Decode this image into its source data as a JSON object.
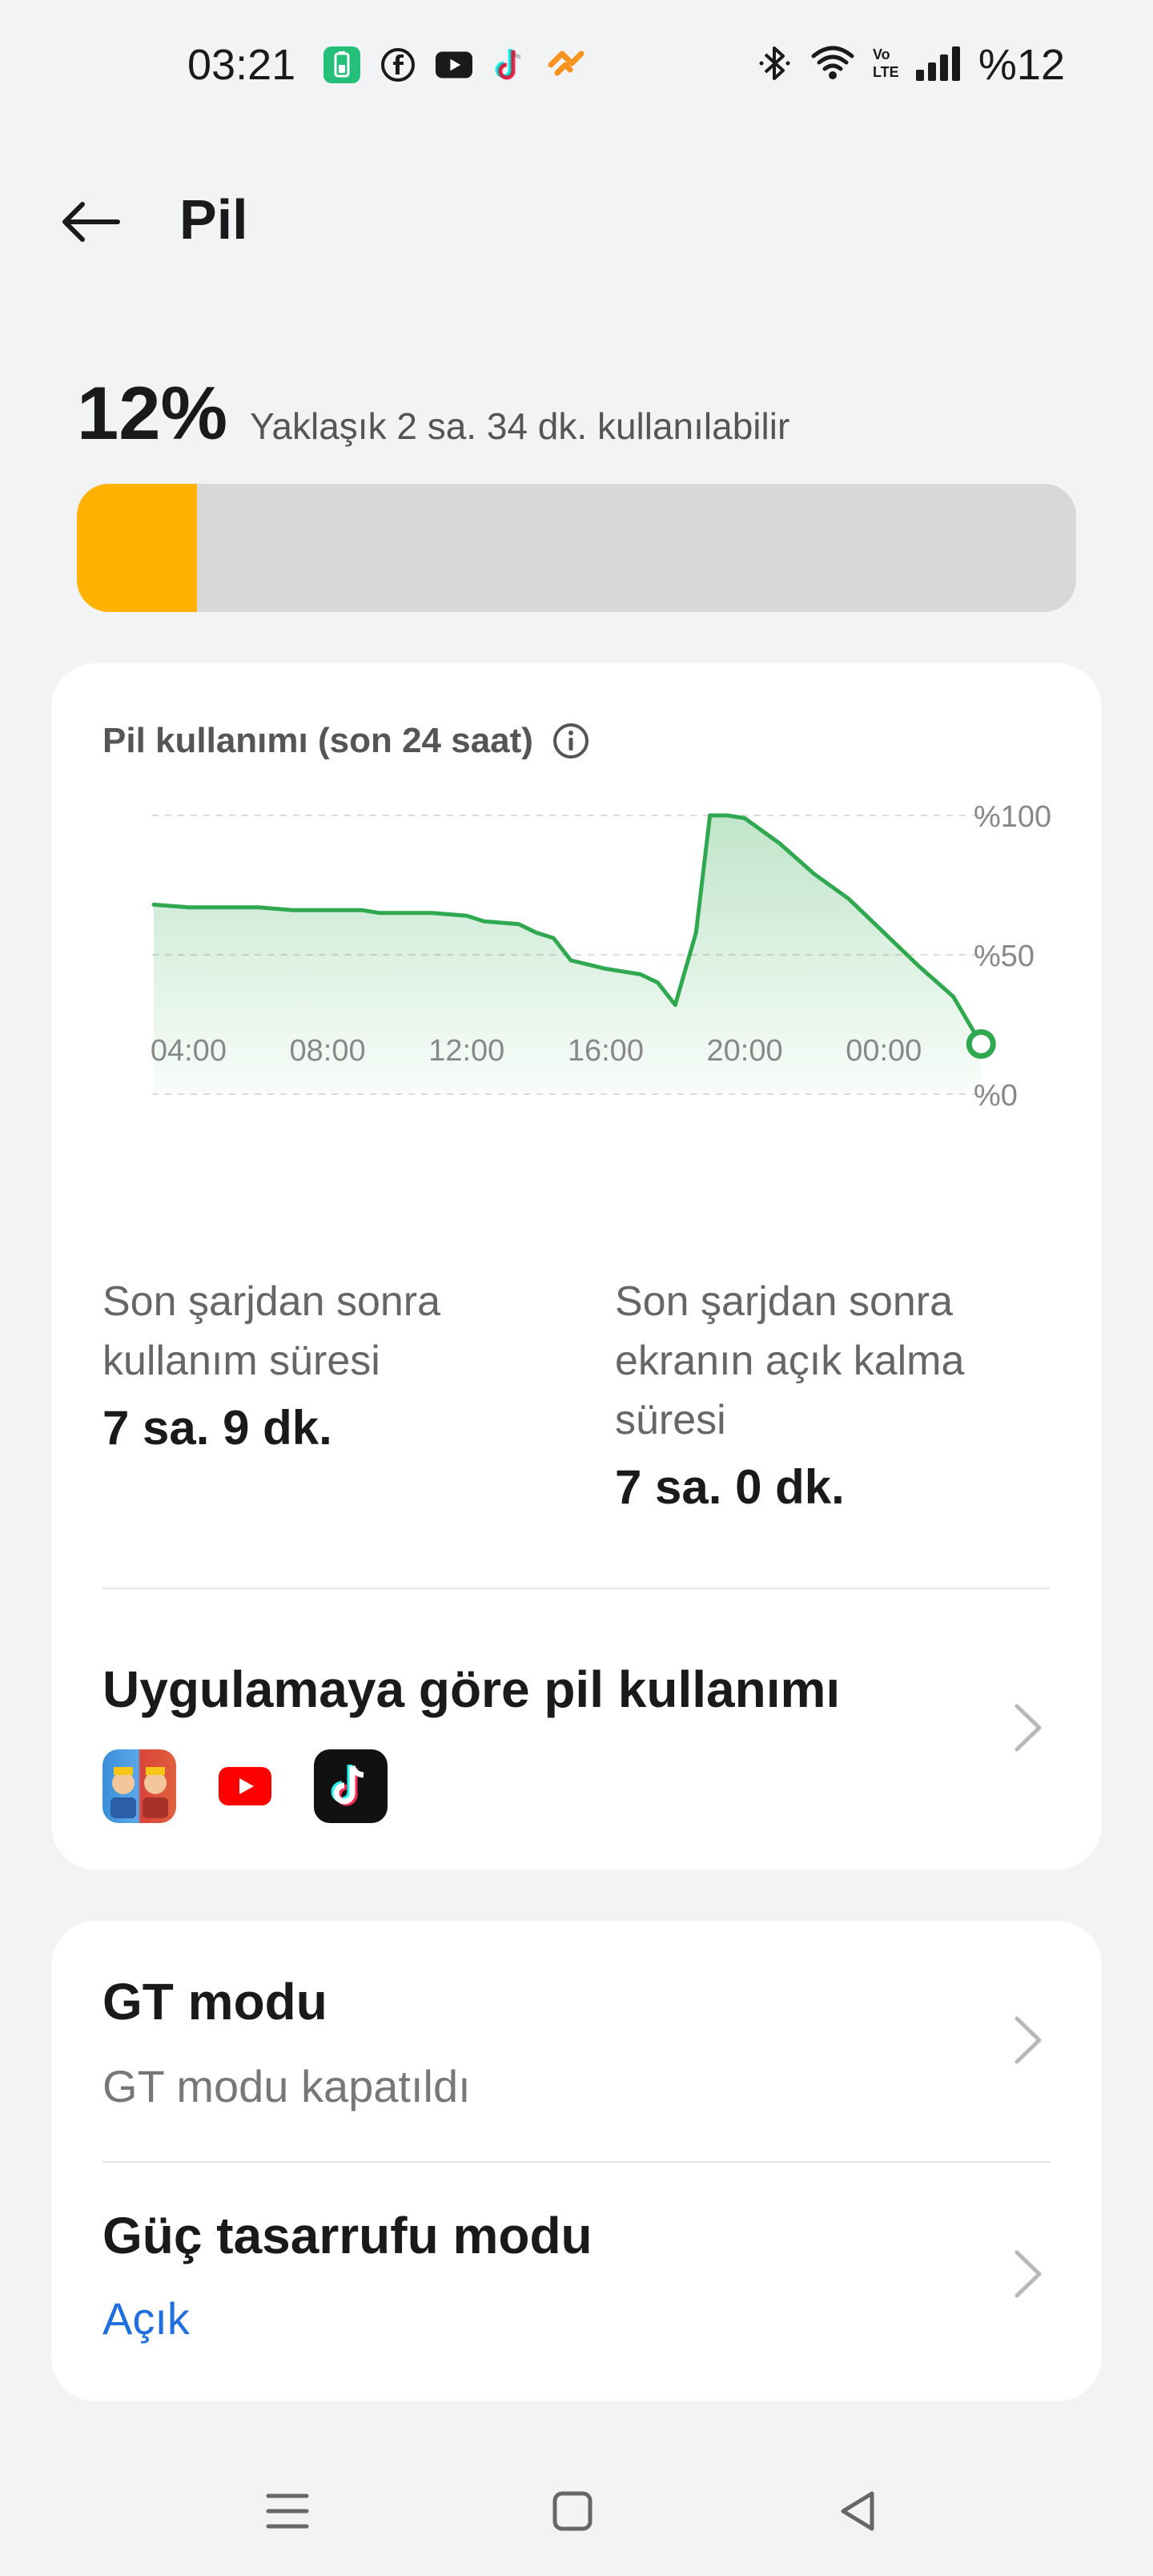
{
  "status_bar": {
    "time": "03:21",
    "battery_text": "%12",
    "notification_icons": [
      "battery-app-icon",
      "facebook-icon",
      "youtube-icon",
      "tiktok-icon",
      "orange-app-icon"
    ],
    "system_icons": [
      "bluetooth-icon",
      "wifi-icon",
      "volte-icon",
      "signal-icon"
    ]
  },
  "header": {
    "title": "Pil"
  },
  "battery": {
    "percent_text": "12%",
    "estimate": "Yaklaşık 2 sa. 34 dk. kullanılabilir",
    "level_fraction": 0.12,
    "fill_color": "#ffb300"
  },
  "usage_card": {
    "title": "Pil kullanımı (son 24 saat)",
    "stats": [
      {
        "label_lines": [
          "Son şarjdan sonra",
          "kullanım süresi"
        ],
        "value": "7 sa. 9 dk."
      },
      {
        "label_lines": [
          "Son şarjdan sonra",
          "ekranın açık kalma",
          "süresi"
        ],
        "value": "7 sa. 0 dk."
      }
    ],
    "app_usage": {
      "title": "Uygulamaya göre pil kullanımı",
      "apps": [
        "clash-royale-icon",
        "youtube-icon",
        "tiktok-icon"
      ]
    }
  },
  "settings_card": {
    "gt_mode": {
      "title": "GT modu",
      "subtitle": "GT modu kapatıldı"
    },
    "power_saving": {
      "title": "Güç tasarrufu modu",
      "subtitle": "Açık",
      "subtitle_color": "#1f6fe0"
    }
  },
  "chart_data": {
    "type": "area",
    "x_ticks": [
      "04:00",
      "08:00",
      "12:00",
      "16:00",
      "20:00",
      "00:00"
    ],
    "y_ticks": [
      "%0",
      "%50",
      "%100"
    ],
    "ylim": [
      0,
      100
    ],
    "x_domain_hours": [
      3,
      27
    ],
    "color": "#2fa84f",
    "points": [
      [
        3.0,
        68
      ],
      [
        4.0,
        67
      ],
      [
        6.0,
        67
      ],
      [
        7.0,
        66
      ],
      [
        9.0,
        66
      ],
      [
        9.5,
        65
      ],
      [
        11.0,
        65
      ],
      [
        12.0,
        64
      ],
      [
        12.5,
        62
      ],
      [
        13.5,
        61
      ],
      [
        14.0,
        58
      ],
      [
        14.5,
        56
      ],
      [
        15.0,
        48
      ],
      [
        16.0,
        45
      ],
      [
        17.0,
        43
      ],
      [
        17.5,
        40
      ],
      [
        18.0,
        32
      ],
      [
        18.6,
        58
      ],
      [
        19.0,
        100
      ],
      [
        19.5,
        100
      ],
      [
        20.0,
        99
      ],
      [
        21.0,
        90
      ],
      [
        22.0,
        79
      ],
      [
        23.0,
        70
      ],
      [
        24.0,
        58
      ],
      [
        25.0,
        46
      ],
      [
        26.0,
        35
      ],
      [
        26.8,
        18
      ]
    ]
  }
}
